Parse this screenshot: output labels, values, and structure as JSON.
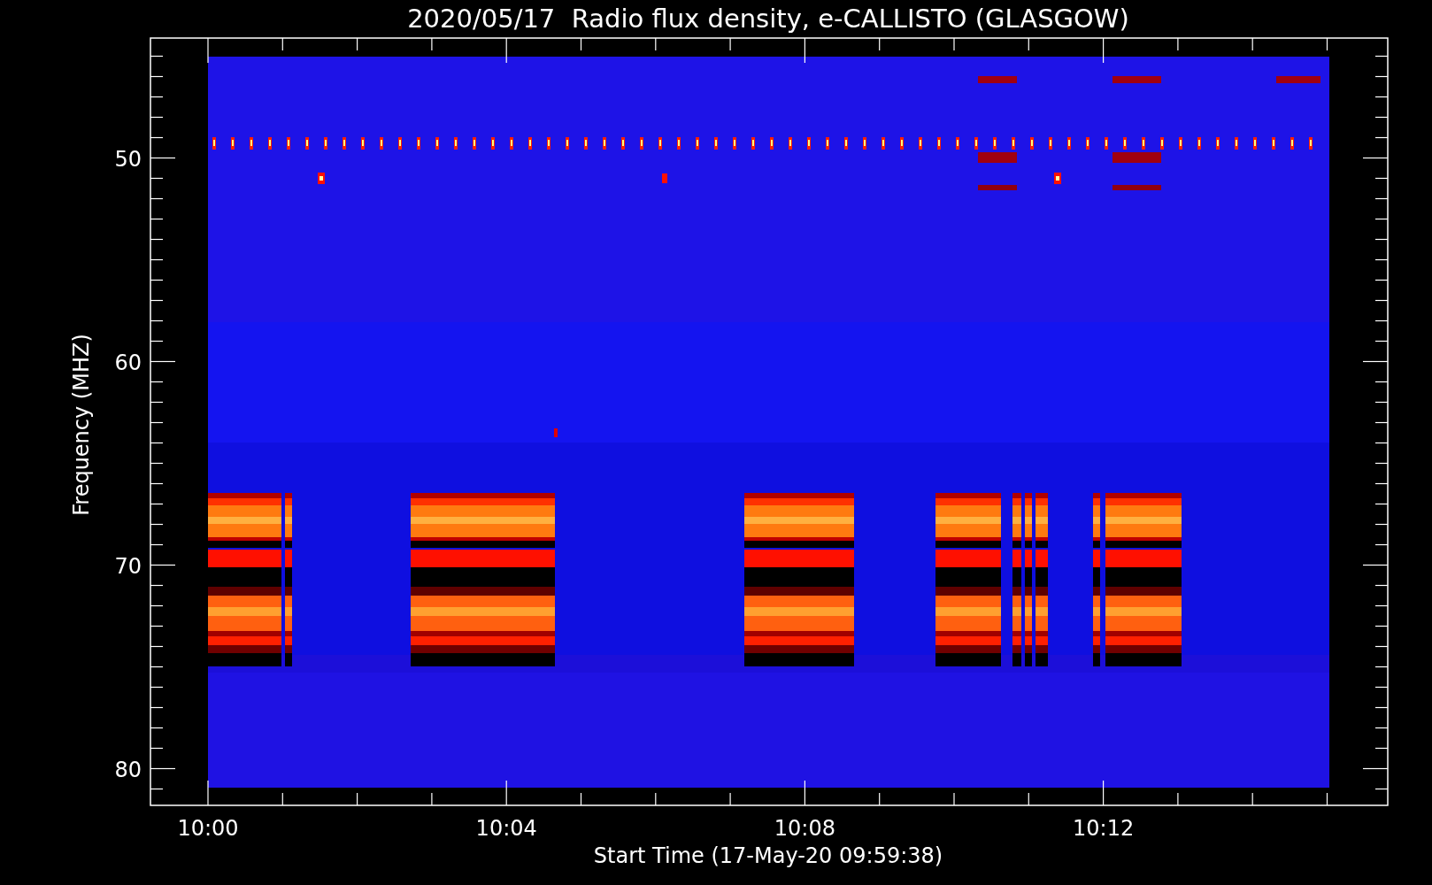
{
  "title": "2020/05/17  Radio flux density, e-CALLISTO (GLASGOW)",
  "y_axis": {
    "label": "Frequency (MHZ)",
    "ticks": [
      "50",
      "60",
      "70",
      "80"
    ]
  },
  "x_axis": {
    "label": "Start Time (17-May-20 09:59:38)",
    "ticks": [
      "10:00",
      "10:04",
      "10:08",
      "10:12"
    ]
  }
}
